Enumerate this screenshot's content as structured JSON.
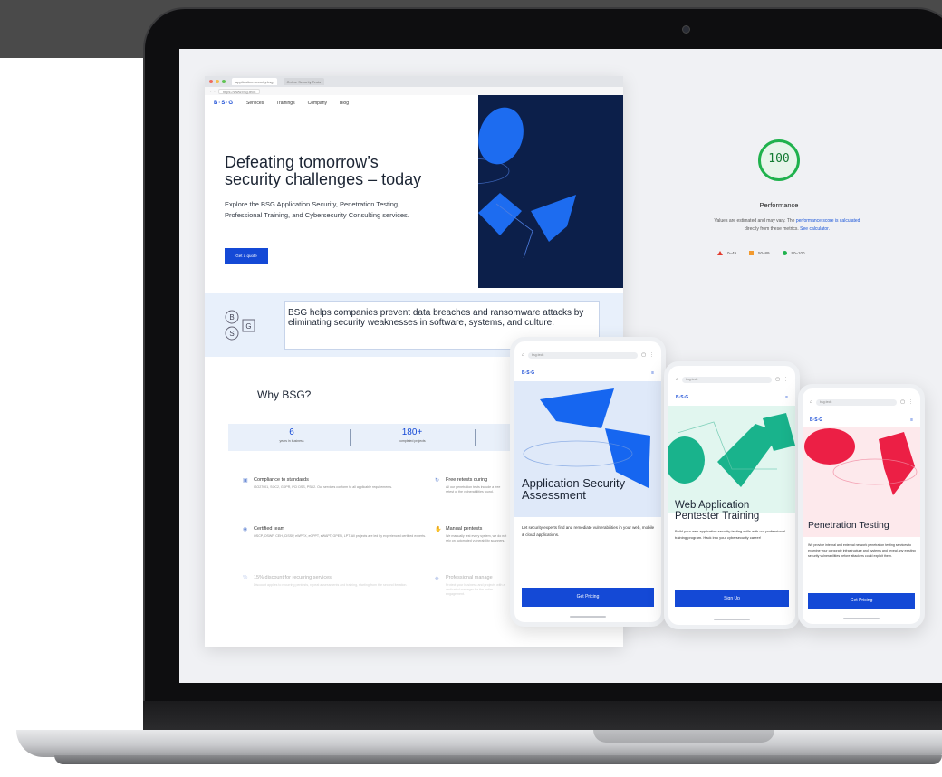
{
  "performance": {
    "score": "100",
    "label": "Performance",
    "note_line1_pre": "Values are estimated and may vary. The ",
    "note_line1_link": "performance score is calculated",
    "note_line2_pre": "directly from these metrics. ",
    "note_line2_link": "See calculator.",
    "legend": [
      "0–49",
      "50–89",
      "90–100"
    ],
    "colors": {
      "fail": "#e23b2e",
      "average": "#f29a2e",
      "pass": "#20b24d"
    }
  },
  "site": {
    "browser_tabs": [
      "application-security.bsg",
      "Online Security Tests"
    ],
    "url": "https://www.bsg.tech",
    "nav_logo": "B·S·G",
    "nav": [
      "Services",
      "Trainings",
      "Company",
      "Blog"
    ],
    "hero_title_line1": "Defeating tomorrow’s",
    "hero_title_line2": "security challenges – today",
    "hero_description": "Explore the BSG Application Security, Penetration Testing, Professional Training, and Cybersecurity Consulting services.",
    "hero_button": "Get a quote",
    "band_text": "BSG helps companies prevent data breaches and ransomware attacks by eliminating security weaknesses in software, systems, and culture.",
    "why_title": "Why BSG?",
    "stats": [
      {
        "value": "6",
        "label": "years in business"
      },
      {
        "value": "180+",
        "label": "completed projects"
      }
    ],
    "features": [
      {
        "title": "Compliance to standards",
        "desc": "ISO27001, SOC2, GDPR, PCI DSS, PSD2. Our services conform to all applicable requirements."
      },
      {
        "title": "Free retests during",
        "desc": "All our penetration tests include a free retest of the vulnerabilities found."
      },
      {
        "title": "Certified team",
        "desc": "OSCP, OSWP, CEH, CISSP, eWPTX, eCPPT, eWAPT, GPEN, LPT. All projects are led by experienced certified experts."
      },
      {
        "title": "Manual pentests",
        "desc": "We manually test every system, we do not rely on automated vulnerability scanners."
      },
      {
        "title": "15% discount for recurring services",
        "desc": "Discount applies to recurring pentests, repeat assessments and training, starting from the second iteration."
      },
      {
        "title": "Professional manage",
        "desc": "Protect your business and projects with a dedicated manager for the entire engagement."
      }
    ],
    "brand_color": "#1449d6",
    "dark_color": "#0c1f4a"
  },
  "phones": [
    {
      "url": "bsg.tech",
      "logo": "B·S·G",
      "title_line1": "Application Security",
      "title_line2": "Assessment",
      "desc": "Let security experts find and remediate vulnerabilities in your web, mobile & cloud applications.",
      "button": "Get Pricing",
      "hero_bg": "#dfe9f9"
    },
    {
      "url": "bsg.tech",
      "logo": "B·S·G",
      "title_line1": "Web Application",
      "title_line2": "Pentester Training",
      "desc": "Build your web application security testing skills with our professional training program. Hack into your cybersecurity career!",
      "button": "Sign Up",
      "hero_bg": "#e1f6ef"
    },
    {
      "url": "bsg.tech",
      "logo": "B·S·G",
      "title_line1": "Penetration Testing",
      "desc": "We provide internal and external network penetration testing services to examine your corporate infrastructure and systems and reveal any existing security vulnerabilities before attackers could exploit them.",
      "button": "Get Pricing",
      "hero_bg": "#fde9ec"
    }
  ]
}
